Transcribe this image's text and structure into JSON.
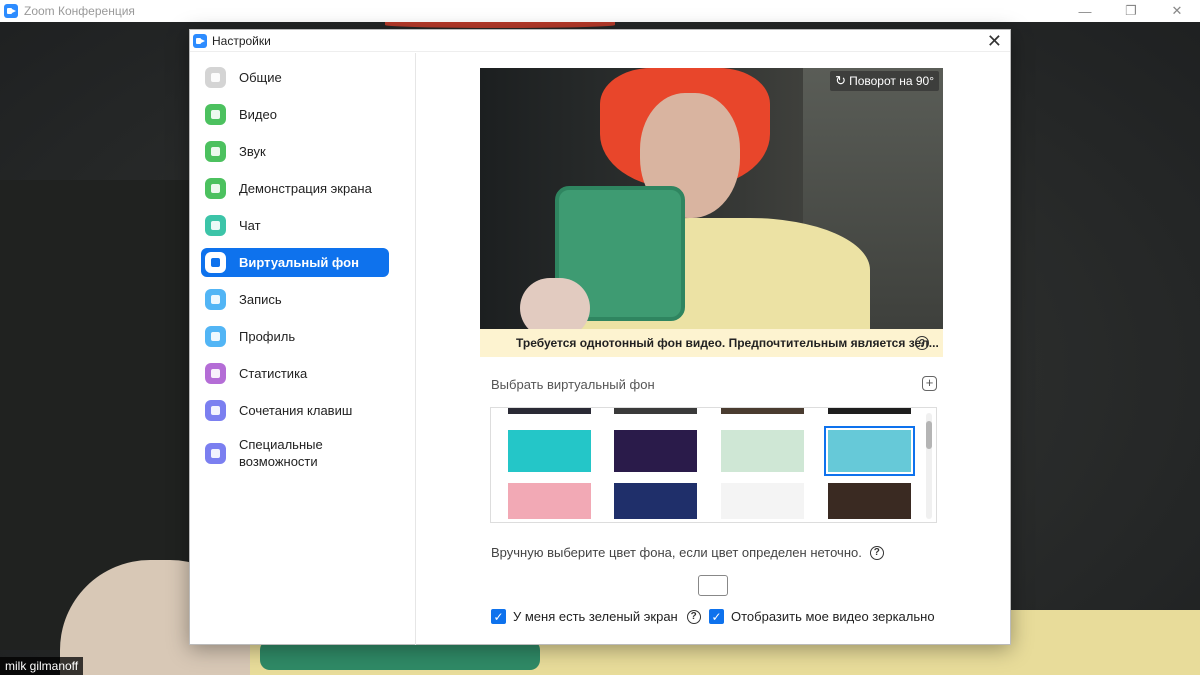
{
  "background_window": {
    "title": "Zoom Конференция",
    "participant_name": "milk gilmanoff",
    "controls": [
      "—",
      "❐",
      "✕"
    ]
  },
  "dialog": {
    "title": "Настройки",
    "close_glyph": "✕"
  },
  "sidebar": {
    "items": [
      {
        "label": "Общие",
        "icon": "gear-icon",
        "color": "#d4d4d4"
      },
      {
        "label": "Видео",
        "icon": "video-icon",
        "color": "#4cc15f"
      },
      {
        "label": "Звук",
        "icon": "headphones-icon",
        "color": "#4cc15f"
      },
      {
        "label": "Демонстрация экрана",
        "icon": "share-screen-icon",
        "color": "#4cc15f"
      },
      {
        "label": "Чат",
        "icon": "chat-icon",
        "color": "#3cc4a8"
      },
      {
        "label": "Виртуальный фон",
        "icon": "virtual-background-icon",
        "color": "#0e72ed",
        "active": true
      },
      {
        "label": "Запись",
        "icon": "record-icon",
        "color": "#52b5f5"
      },
      {
        "label": "Профиль",
        "icon": "profile-icon",
        "color": "#52b5f5"
      },
      {
        "label": "Статистика",
        "icon": "statistics-icon",
        "color": "#b46dd6"
      },
      {
        "label": "Сочетания клавиш",
        "icon": "keyboard-icon",
        "color": "#7b7ff0"
      },
      {
        "label": "Специальные возможности",
        "icon": "accessibility-icon",
        "color": "#7b7ff0"
      }
    ]
  },
  "content": {
    "rotate_label": "Поворот на 90°",
    "warning_text": "Требуется однотонный фон видео. Предпочтительным является зел...",
    "choose_label": "Выбрать виртуальный фон",
    "add_glyph": "+",
    "manual_color_text": "Вручную выберите цвет фона, если цвет определен неточно.",
    "green_screen_label": "У меня есть зеленый экран",
    "mirror_label": "Отобразить мое видео зеркально",
    "help_glyph": "?",
    "check_glyph": "✓"
  },
  "gallery": {
    "thumbs": [
      {
        "name": "thumb-dark-1",
        "bg": "#2a2a35"
      },
      {
        "name": "thumb-dark-2",
        "bg": "#3a3a3a"
      },
      {
        "name": "thumb-dark-3",
        "bg": "#4a3c30"
      },
      {
        "name": "thumb-dark-4",
        "bg": "#1e1e1e"
      },
      {
        "name": "thumb-pizza",
        "bg": "#24c6c8"
      },
      {
        "name": "thumb-lasers",
        "bg": "#2a1b4a"
      },
      {
        "name": "thumb-leaves",
        "bg": "#cfe7d5"
      },
      {
        "name": "thumb-dogs",
        "bg": "#66c9d8",
        "selected": true
      },
      {
        "name": "thumb-pets",
        "bg": "#f2a9b5"
      },
      {
        "name": "thumb-nebula",
        "bg": "#1f2f6a"
      },
      {
        "name": "thumb-icons",
        "bg": "#f4f4f4"
      },
      {
        "name": "thumb-tunnel",
        "bg": "#3a2a22"
      }
    ]
  }
}
